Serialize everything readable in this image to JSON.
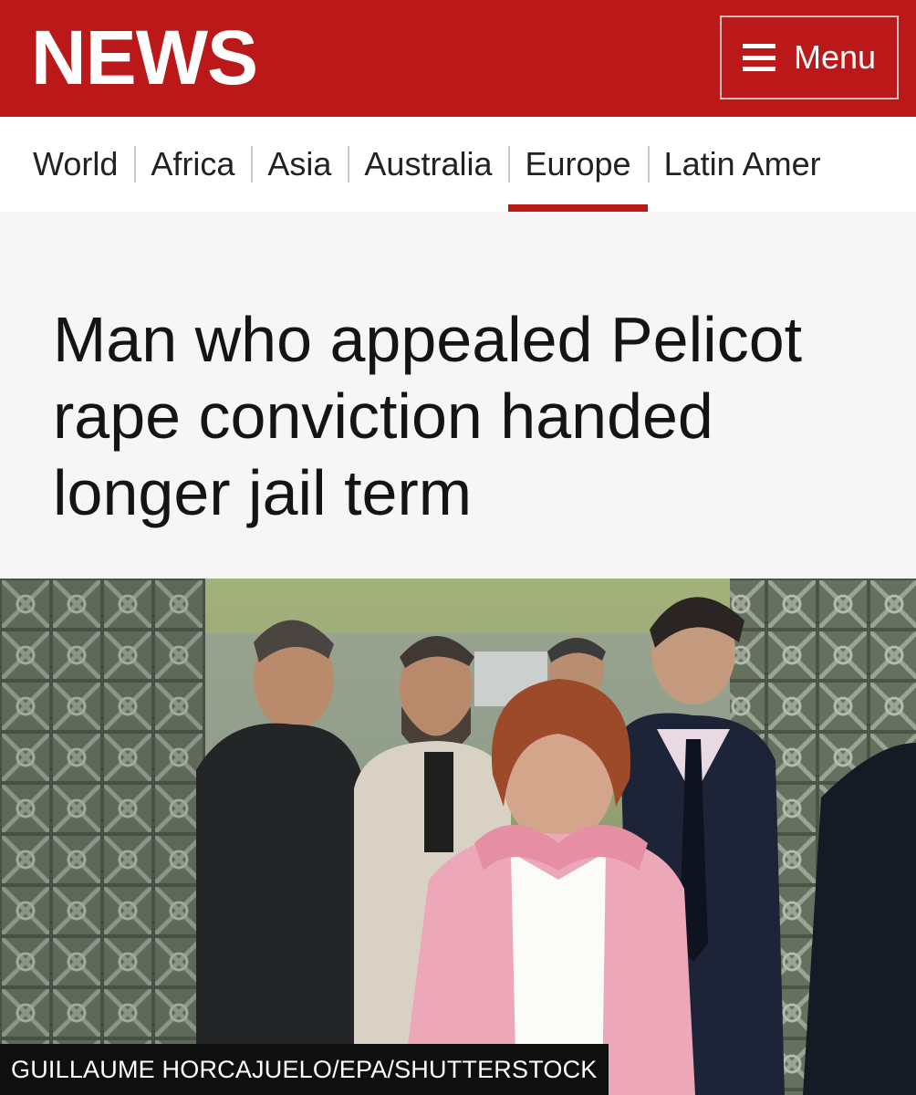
{
  "header": {
    "logo_text": "NEWS",
    "menu_label": "Menu",
    "brand_color": "#bb1919"
  },
  "nav": {
    "items": [
      {
        "label": "World",
        "active": false
      },
      {
        "label": "Africa",
        "active": false
      },
      {
        "label": "Asia",
        "active": false
      },
      {
        "label": "Australia",
        "active": false
      },
      {
        "label": "Europe",
        "active": true
      },
      {
        "label": "Latin Amer",
        "active": false
      }
    ]
  },
  "article": {
    "headline": "Man who appealed Pelicot rape conviction handed longer jail term",
    "image": {
      "credit": "GUILLAUME HORCAJUELO/EPA/SHUTTERSTOCK"
    }
  }
}
